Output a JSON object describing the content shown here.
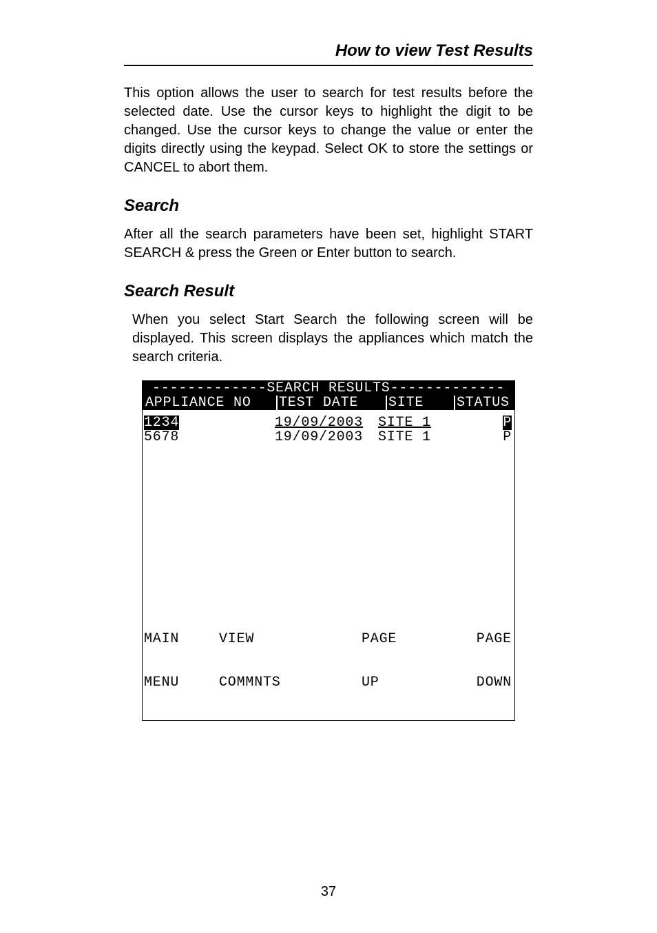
{
  "header": {
    "title": "How to view Test Results"
  },
  "intro": "This option allows the user to search for test results before the selected date.  Use the cursor keys to highlight the digit to be changed. Use the cursor keys to change the value or enter the digits directly using the keypad. Select OK to store the settings or CANCEL to abort them.",
  "sections": {
    "search": {
      "heading": "Search",
      "text": "After all the search parameters have been set, highlight START SEARCH & press the Green or Enter button to search."
    },
    "result": {
      "heading": "Search Result",
      "text": "When you select Start Search the following screen will be displayed. This screen displays the appliances which match the search criteria."
    }
  },
  "lcd": {
    "title": "-------------SEARCH RESULTS-------------",
    "headers": {
      "appliance": "APPLIANCE NO",
      "date": "TEST DATE",
      "site": "SITE",
      "status": "STATUS"
    },
    "rows": [
      {
        "appliance": "1234",
        "date": "19/09/2003",
        "site": "SITE 1",
        "status": "P",
        "selected": true
      },
      {
        "appliance": "5678",
        "date": "19/09/2003",
        "site": "SITE 1",
        "status": "P",
        "selected": false
      }
    ],
    "footer": {
      "c1a": "MAIN",
      "c1b": "MENU",
      "c2a": "VIEW",
      "c2b": "COMMNTS",
      "c3a": "PAGE",
      "c3b": "UP",
      "c4a": "PAGE",
      "c4b": "DOWN"
    }
  },
  "pageNumber": "37"
}
